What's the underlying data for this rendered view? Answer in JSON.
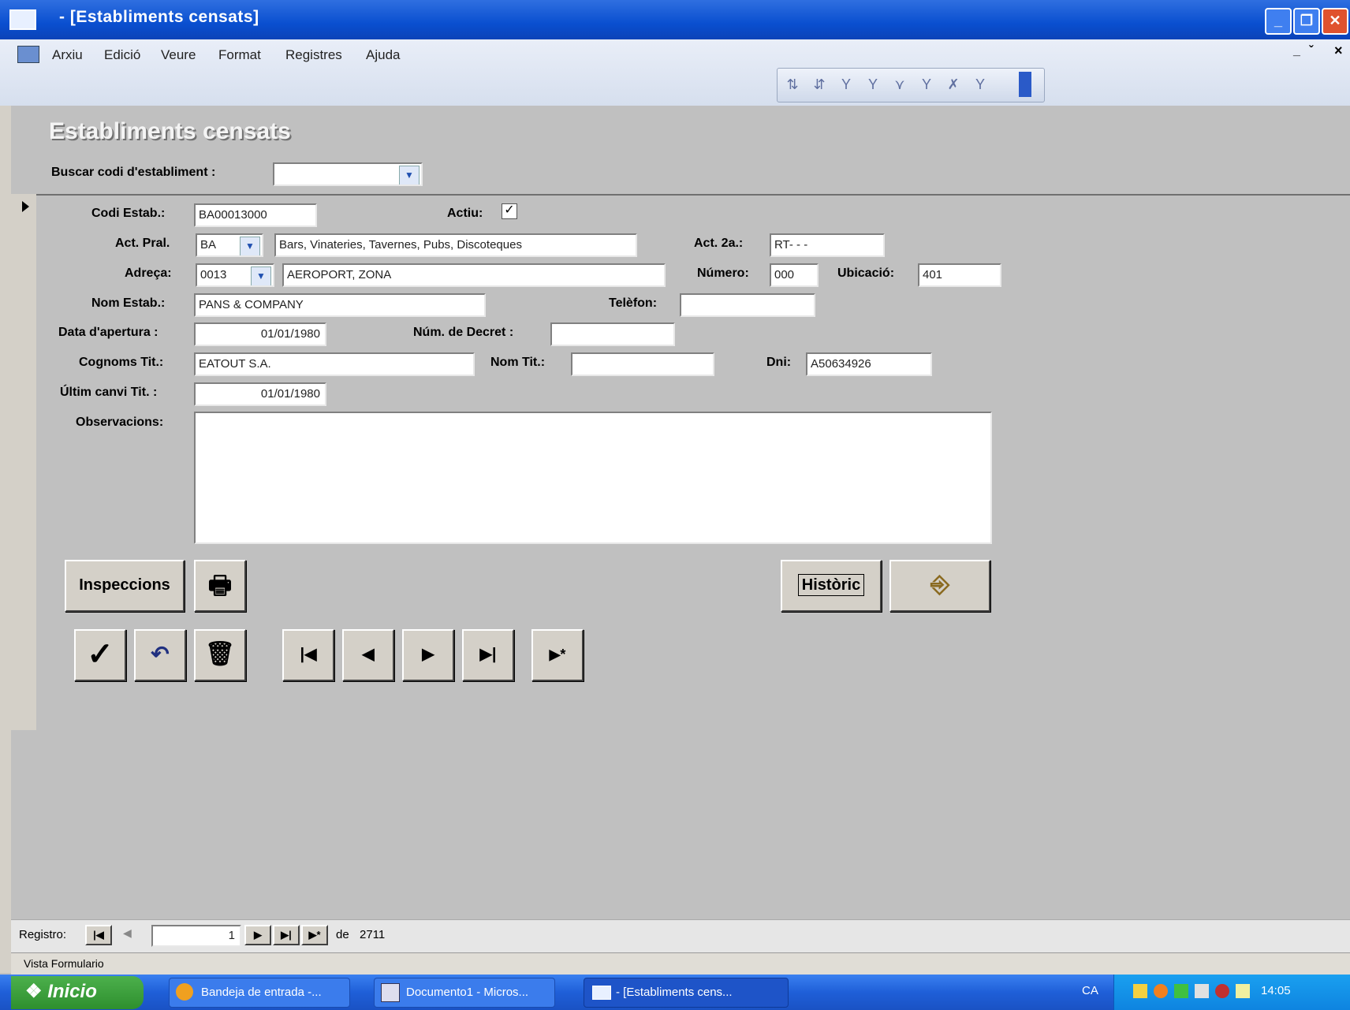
{
  "window": {
    "title": "- [Establiments censats]",
    "minimize_glyph": "_",
    "restore_glyph": "❐",
    "close_glyph": "✕"
  },
  "menu": [
    "Arxiu",
    "Edició",
    "Veure",
    "Format",
    "Registres",
    "Ajuda"
  ],
  "menu_right": {
    "min": "_",
    "restore": "ˇ",
    "close": "×"
  },
  "toolbar_icons": [
    "sort-ascending-icon",
    "sort-descending-icon",
    "filter-by-selection-icon",
    "filter-by-form-icon",
    "apply-filter-icon",
    "toggle-filter-icon",
    "remove-filter-icon",
    "find-icon"
  ],
  "form": {
    "title": "Establiments censats",
    "search_label": "Buscar codi d'establiment :",
    "search_value": "",
    "labels": {
      "codi": "Codi Estab.:",
      "actiu": "Actiu:",
      "act_pral": "Act. Pral.",
      "act_2a": "Act. 2a.:",
      "adreca": "Adreça:",
      "numero": "Número:",
      "ubicacio": "Ubicació:",
      "nom_estab": "Nom Estab.:",
      "telefon": "Telèfon:",
      "data_apertura": "Data d'apertura :",
      "num_decret": "Núm. de Decret :",
      "cognoms_tit": "Cognoms Tit.:",
      "nom_tit": "Nom Tit.:",
      "dni": "Dni:",
      "ultim_canvi": "Últim canvi Tit. :",
      "observacions": "Observacions:"
    },
    "values": {
      "codi": "BA00013000",
      "actiu": true,
      "act_pral_code": "BA",
      "act_pral_desc": "Bars, Vinateries, Tavernes, Pubs, Discoteques",
      "act_2a": "RT- - -",
      "adreca_code": "0013",
      "adreca_desc": "AEROPORT, ZONA",
      "numero": "000",
      "ubicacio": "401",
      "nom_estab": "PANS & COMPANY",
      "telefon": "",
      "data_apertura": "01/01/1980",
      "num_decret": "",
      "cognoms_tit": "EATOUT S.A.",
      "nom_tit": "",
      "dni": "A50634926",
      "ultim_canvi": "01/01/1980",
      "observacions": ""
    },
    "buttons": {
      "inspeccions": "Inspeccions",
      "historic": "Històric"
    }
  },
  "navigation": {
    "label": "Registro:",
    "current": "1",
    "of_label": "de",
    "total": "2711"
  },
  "status_text": "Vista Formulario",
  "taskbar": {
    "start": "Inicio",
    "tasks": [
      "Bandeja de entrada -...",
      "Documento1 - Micros...",
      "- [Establiments cens..."
    ],
    "lang": "CA",
    "clock": "14:05"
  }
}
